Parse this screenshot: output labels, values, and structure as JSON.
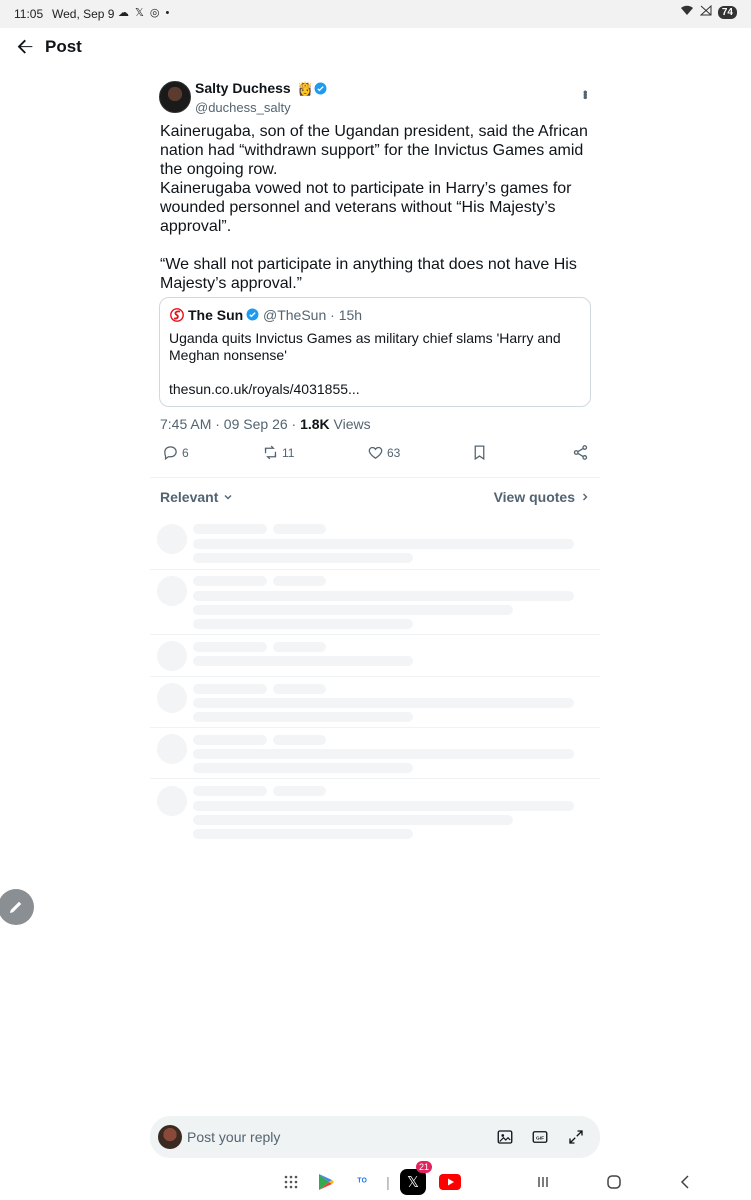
{
  "status_bar": {
    "time": "11:05",
    "date": "Wed, Sep 9",
    "battery": "74"
  },
  "header": {
    "title": "Post"
  },
  "tweet": {
    "author_name": "Salty Duchess",
    "author_emoji": "👸",
    "author_handle": "@duchess_salty",
    "text": "Kainerugaba, son of the Ugandan president, said the African nation had “withdrawn support” for the Invictus Games amid the ongoing row.\nKainerugaba vowed not to participate in Harry’s games for wounded personnel and veterans without “His Majesty’s approval”.\n\n“We shall not participate in anything that does not have His Majesty’s approval.”",
    "quote": {
      "name": "The Sun",
      "handle": "@TheSun · 15h",
      "text": "Uganda quits Invictus Games as military chief slams 'Harry and Meghan nonsense'",
      "link": "thesun.co.uk/royals/4031855..."
    },
    "timestamp": "7:45 AM · 09 Sep 26 · ",
    "views_count": "1.8K",
    "views_label": " Views",
    "replies": "6",
    "reposts": "11",
    "likes": "63"
  },
  "sort": {
    "relevant_label": "Relevant",
    "view_quotes_label": "View quotes"
  },
  "reply_box": {
    "placeholder": "Post your reply"
  },
  "nav": {
    "x_badge": "21"
  },
  "colors": {
    "verified": "#1d9bf0",
    "sun_red": "#e4111b",
    "text": "#0f1419",
    "secondary": "#536471"
  }
}
